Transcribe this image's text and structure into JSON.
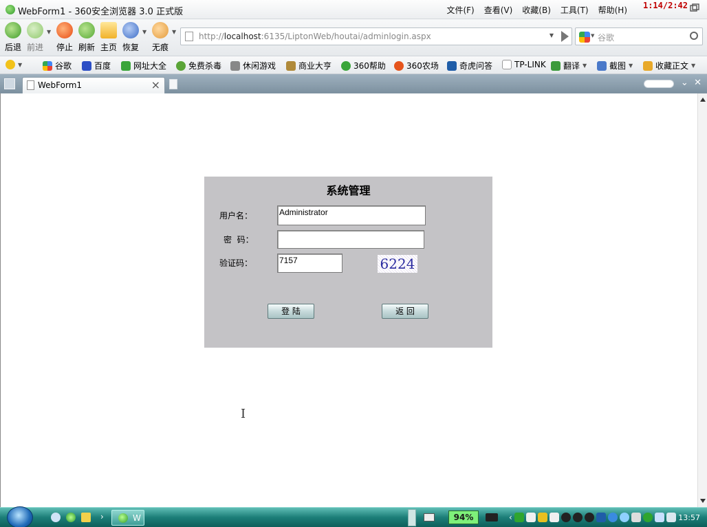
{
  "window": {
    "title": "WebForm1 - 360安全浏览器 3.0 正式版",
    "menus": [
      "文件(F)",
      "查看(V)",
      "收藏(B)",
      "工具(T)",
      "帮助(H)"
    ],
    "overlay_counter": "1:14/2:42"
  },
  "nav": {
    "back": "后退",
    "forward": "前进",
    "stop": "停止",
    "refresh": "刷新",
    "home": "主页",
    "restore": "恢复",
    "incognito": "无痕"
  },
  "address": {
    "url_prefix": "http://",
    "url_host": "localhost",
    "url_rest": ":6135/LiptonWeb/houtai/adminlogin.aspx"
  },
  "search": {
    "placeholder": "谷歌"
  },
  "favorites": [
    "谷歌",
    "百度",
    "网址大全",
    "免费杀毒",
    "休闲游戏",
    "商业大亨",
    "360帮助",
    "360农场",
    "奇虎问答",
    "TP-LINK",
    "翻译",
    "截图",
    "收藏正文"
  ],
  "tab": {
    "title": "WebForm1"
  },
  "login": {
    "title": "系统管理",
    "username_label": "用户名：",
    "username_value": "Administrator",
    "password_label": "密  码：",
    "password_value": "",
    "captcha_label": "验证码：",
    "captcha_input": "7157",
    "captcha_image": "6224",
    "login_button": "登 陆",
    "back_button": "返 回"
  },
  "taskbar": {
    "task_label": "W",
    "battery": "94%",
    "clock": "13:57"
  },
  "colors": {
    "panel_bg": "#c4c3c6",
    "overlay_red": "#c00000",
    "taskbar_teal": "#1c7e78"
  }
}
